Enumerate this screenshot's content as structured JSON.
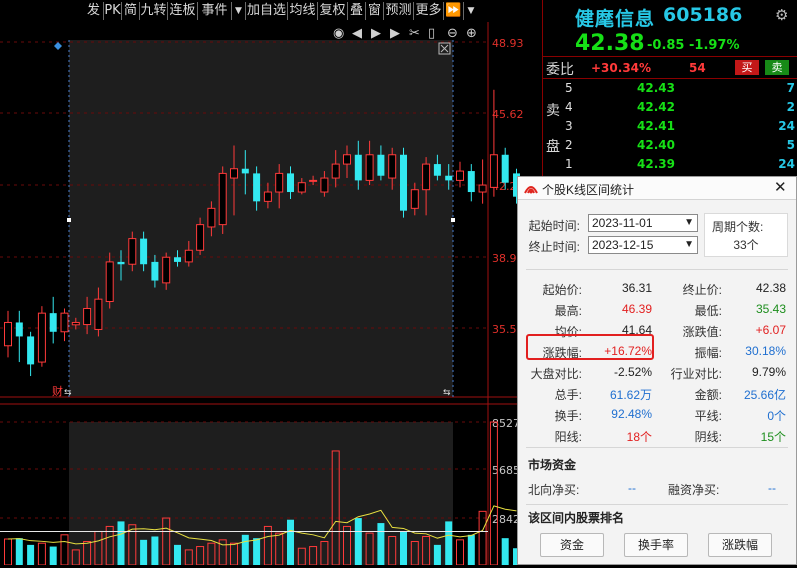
{
  "toolbar": {
    "items": [
      "发",
      "PK",
      "简",
      "九转",
      "连板",
      "事件",
      "加自选",
      "均线",
      "复权",
      "叠",
      "窗",
      "预测",
      "更多"
    ],
    "arrow_icon": "caret-down-icon",
    "ff_icon": "fast-forward-icon"
  },
  "chart": {
    "price_ticks": [
      "48.93",
      "45.62",
      "42.2",
      "38.9",
      "35.5"
    ],
    "volume_ticks": [
      "8527",
      "5685",
      "2842"
    ],
    "tool_icons": [
      "eye-icon",
      "prev-icon",
      "play-icon",
      "next-icon",
      "scissors-icon",
      "lock-icon",
      "zoom-out-icon",
      "zoom-in-icon"
    ],
    "fin_label": "财",
    "candles": [
      {
        "o": 35.4,
        "c": 36.4,
        "h": 36.9,
        "l": 34.9
      },
      {
        "o": 36.4,
        "c": 35.8,
        "h": 36.9,
        "l": 34.7
      },
      {
        "o": 35.8,
        "c": 34.6,
        "h": 36.0,
        "l": 34.1
      },
      {
        "o": 34.7,
        "c": 36.8,
        "h": 37.1,
        "l": 34.5
      },
      {
        "o": 36.8,
        "c": 36.0,
        "h": 37.5,
        "l": 35.5
      },
      {
        "o": 36.0,
        "c": 36.8,
        "h": 37.0,
        "l": 35.6
      },
      {
        "o": 36.3,
        "c": 36.4,
        "h": 36.6,
        "l": 36.1
      },
      {
        "o": 36.31,
        "c": 37.0,
        "h": 37.5,
        "l": 35.9
      },
      {
        "o": 36.1,
        "c": 37.4,
        "h": 37.9,
        "l": 35.8
      },
      {
        "o": 37.3,
        "c": 39.0,
        "h": 39.4,
        "l": 37.0
      },
      {
        "o": 39.0,
        "c": 38.9,
        "h": 39.5,
        "l": 38.2
      },
      {
        "o": 38.9,
        "c": 40.0,
        "h": 40.3,
        "l": 38.6
      },
      {
        "o": 40.0,
        "c": 38.9,
        "h": 40.3,
        "l": 38.6
      },
      {
        "o": 39.0,
        "c": 38.2,
        "h": 39.3,
        "l": 37.9
      },
      {
        "o": 38.1,
        "c": 39.2,
        "h": 39.4,
        "l": 37.8
      },
      {
        "o": 39.2,
        "c": 39.0,
        "h": 39.5,
        "l": 38.8
      },
      {
        "o": 39.0,
        "c": 39.5,
        "h": 39.9,
        "l": 38.8
      },
      {
        "o": 39.5,
        "c": 40.6,
        "h": 40.9,
        "l": 39.3
      },
      {
        "o": 40.5,
        "c": 41.3,
        "h": 41.6,
        "l": 40.1
      },
      {
        "o": 40.6,
        "c": 42.8,
        "h": 43.1,
        "l": 40.2
      },
      {
        "o": 42.6,
        "c": 43.0,
        "h": 44.0,
        "l": 41.0
      },
      {
        "o": 43.0,
        "c": 42.8,
        "h": 43.8,
        "l": 41.9
      },
      {
        "o": 42.8,
        "c": 41.6,
        "h": 43.1,
        "l": 41.2
      },
      {
        "o": 41.6,
        "c": 42.0,
        "h": 42.4,
        "l": 41.3
      },
      {
        "o": 42.0,
        "c": 42.8,
        "h": 43.2,
        "l": 41.3
      },
      {
        "o": 42.8,
        "c": 42.0,
        "h": 43.1,
        "l": 41.7
      },
      {
        "o": 42.0,
        "c": 42.4,
        "h": 42.6,
        "l": 41.9
      },
      {
        "o": 42.5,
        "c": 42.5,
        "h": 42.7,
        "l": 42.3
      },
      {
        "o": 42.0,
        "c": 42.6,
        "h": 42.9,
        "l": 41.8
      },
      {
        "o": 42.6,
        "c": 43.2,
        "h": 43.8,
        "l": 42.2
      },
      {
        "o": 43.2,
        "c": 43.6,
        "h": 44.0,
        "l": 42.6
      },
      {
        "o": 43.6,
        "c": 42.5,
        "h": 44.2,
        "l": 42.1
      },
      {
        "o": 42.5,
        "c": 43.6,
        "h": 44.2,
        "l": 42.3
      },
      {
        "o": 43.6,
        "c": 42.7,
        "h": 44.0,
        "l": 42.5
      },
      {
        "o": 42.6,
        "c": 43.6,
        "h": 43.9,
        "l": 42.1
      },
      {
        "o": 43.6,
        "c": 41.2,
        "h": 43.9,
        "l": 40.9
      },
      {
        "o": 41.3,
        "c": 42.1,
        "h": 42.4,
        "l": 41.0
      },
      {
        "o": 42.1,
        "c": 43.2,
        "h": 43.5,
        "l": 41.0
      },
      {
        "o": 43.2,
        "c": 42.7,
        "h": 43.6,
        "l": 42.5
      },
      {
        "o": 42.7,
        "c": 42.5,
        "h": 43.2,
        "l": 42.1
      },
      {
        "o": 42.5,
        "c": 42.9,
        "h": 43.3,
        "l": 42.2
      },
      {
        "o": 42.9,
        "c": 42.0,
        "h": 43.2,
        "l": 41.6
      },
      {
        "o": 42.0,
        "c": 42.3,
        "h": 43.4,
        "l": 41.5
      },
      {
        "o": 42.2,
        "c": 43.6,
        "h": 46.39,
        "l": 41.8
      },
      {
        "o": 43.6,
        "c": 42.4,
        "h": 43.9,
        "l": 42.1
      },
      {
        "o": 42.8,
        "c": 41.8,
        "h": 43.0,
        "l": 41.5
      }
    ],
    "volumes": [
      1550,
      1600,
      1200,
      1300,
      1100,
      1800,
      900,
      1400,
      2000,
      2300,
      2600,
      2400,
      1500,
      1700,
      2800,
      1200,
      900,
      1100,
      1300,
      1500,
      1300,
      1800,
      1600,
      2300,
      1900,
      2700,
      1000,
      1100,
      1400,
      6800,
      2300,
      2800,
      1900,
      2500,
      1700,
      2000,
      1400,
      1700,
      1200,
      2600,
      1500,
      1800,
      3200,
      8527,
      1600,
      1000
    ]
  },
  "quote": {
    "name": "健麾信息",
    "code": "605186",
    "price": "42.38",
    "change": "-0.85",
    "change_pct": "-1.97%",
    "wb_label": "委比",
    "wb_value": "+30.34%",
    "wb_count": "54",
    "buy_btn": "买",
    "sell_btn": "卖",
    "side_label_1": "卖",
    "side_label_2": "盘",
    "asks": [
      {
        "level": "5",
        "price": "42.43",
        "vol": "7"
      },
      {
        "level": "4",
        "price": "42.42",
        "vol": "2"
      },
      {
        "level": "3",
        "price": "42.41",
        "vol": "24"
      },
      {
        "level": "2",
        "price": "42.40",
        "vol": "5"
      },
      {
        "level": "1",
        "price": "42.39",
        "vol": "24"
      }
    ]
  },
  "popup": {
    "title": "个股K线区间统计",
    "start_label": "起始时间:",
    "start_date": "2023-11-01",
    "end_label": "终止时间:",
    "end_date": "2023-12-15",
    "period_label": "周期个数:",
    "period_value": "33个",
    "stats": [
      {
        "l1": "起始价:",
        "v1": "36.31",
        "c1": "black",
        "l2": "终止价:",
        "v2": "42.38",
        "c2": "black"
      },
      {
        "l1": "最高:",
        "v1": "46.39",
        "c1": "red",
        "l2": "最低:",
        "v2": "35.43",
        "c2": "green"
      },
      {
        "l1": "均价:",
        "v1": "41.64",
        "c1": "black",
        "l2": "涨跌值:",
        "v2": "+6.07",
        "c2": "red"
      },
      {
        "l1": "涨跌幅:",
        "v1": "+16.72%",
        "c1": "red",
        "l2": "振幅:",
        "v2": "30.18%",
        "c2": "blue"
      },
      {
        "l1": "大盘对比:",
        "v1": "-2.52%",
        "c1": "black",
        "l2": "行业对比:",
        "v2": "9.79%",
        "c2": "black"
      },
      {
        "l1": "总手:",
        "v1": "61.62万",
        "c1": "blue",
        "l2": "金额:",
        "v2": "25.66亿",
        "c2": "blue"
      },
      {
        "l1": "换手:",
        "v1": "92.48%",
        "c1": "blue",
        "l2": "平线:",
        "v2": "0个",
        "c2": "blue"
      },
      {
        "l1": "阳线:",
        "v1": "18个",
        "c1": "red",
        "l2": "阴线:",
        "v2": "15个",
        "c2": "green"
      }
    ],
    "market_title": "市场资金",
    "north_label": "北向净买:",
    "north_value": "--",
    "margin_label": "融资净买:",
    "margin_value": "--",
    "rank_title": "该区间内股票排名",
    "buttons": [
      "资金",
      "换手率",
      "涨跌幅"
    ]
  },
  "colors": {
    "up": "#ff3a3a",
    "down": "#33e8f0",
    "highlight_box": "#e21f1f"
  }
}
